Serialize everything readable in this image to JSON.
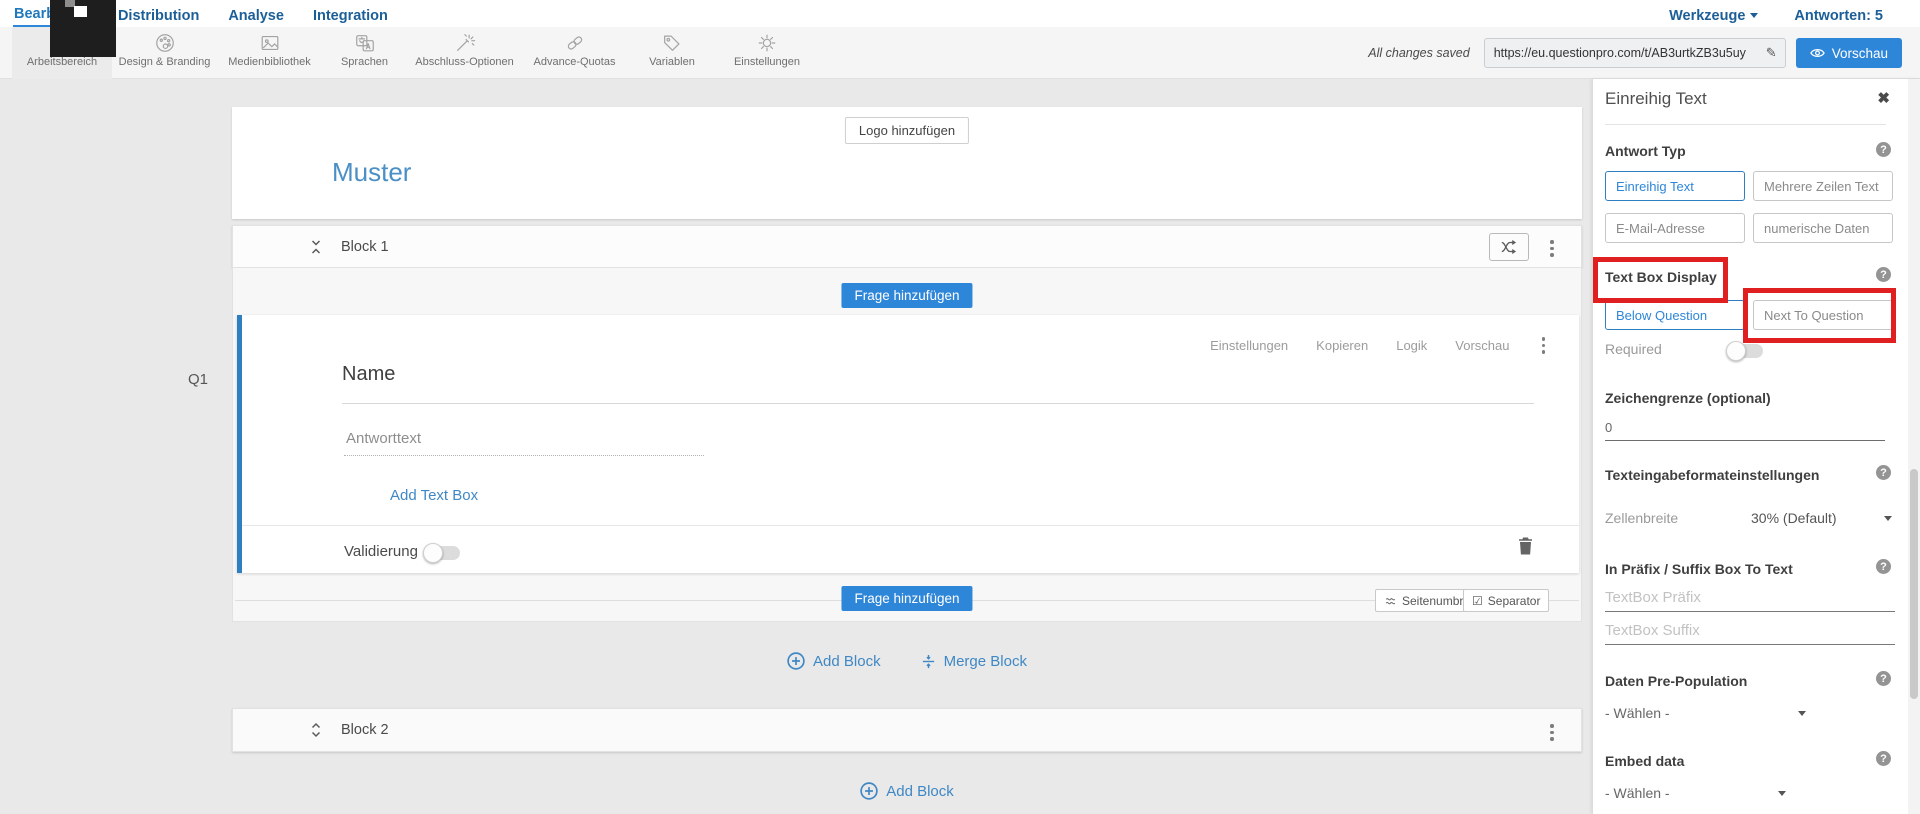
{
  "nav": {
    "tabs": [
      {
        "label": "Bearbeiten"
      },
      {
        "label": "Distribution"
      },
      {
        "label": "Analyse"
      },
      {
        "label": "Integration"
      }
    ],
    "tools_label": "Werkzeuge",
    "responses_label": "Antworten: 5"
  },
  "toolbar": {
    "items": [
      {
        "label": "Arbeitsbereich"
      },
      {
        "label": "Design & Branding"
      },
      {
        "label": "Medienbibliothek"
      },
      {
        "label": "Sprachen"
      },
      {
        "label": "Abschluss-Optionen"
      },
      {
        "label": "Advance-Quotas"
      },
      {
        "label": "Variablen"
      },
      {
        "label": "Einstellungen"
      }
    ],
    "save_status": "All changes saved",
    "url": "https://eu.questionpro.com/t/AB3urtkZB3u5uy",
    "preview_label": "Vorschau"
  },
  "canvas": {
    "logo_button": "Logo hinzufügen",
    "survey_title": "Muster",
    "question_number": "Q1",
    "block1_title": "Block 1",
    "block2_title": "Block 2",
    "add_question_label": "Frage hinzufügen",
    "question": {
      "actions": [
        {
          "label": "Einstellungen"
        },
        {
          "label": "Kopieren"
        },
        {
          "label": "Logik"
        },
        {
          "label": "Vorschau"
        }
      ],
      "name_label": "Name",
      "answer_placeholder": "Antworttext",
      "add_text_box_label": "Add Text Box",
      "validation_label": "Validierung"
    },
    "page_break_label": "Seitenumbruch",
    "separator_label": "Separator",
    "separator_checkbox_icon": "☑",
    "add_block_label": "Add Block",
    "merge_block_label": "Merge Block",
    "add_block_bottom_label": "Add Block"
  },
  "sidebar": {
    "title": "Einreihig Text",
    "close_icon": "✖",
    "help_icon": "?",
    "answer_type": {
      "label": "Antwort Typ",
      "options": [
        {
          "label": "Einreihig Text"
        },
        {
          "label": "Mehrere Zeilen Text"
        },
        {
          "label": "E-Mail-Adresse"
        },
        {
          "label": "numerische Daten"
        }
      ]
    },
    "text_box_display": {
      "label": "Text Box Display",
      "options": [
        {
          "label": "Below Question"
        },
        {
          "label": "Next To Question"
        }
      ]
    },
    "required_label": "Required",
    "char_limit": {
      "label": "Zeichengrenze (optional)",
      "value": "0"
    },
    "text_format": {
      "label": "Texteingabeformateinstellungen",
      "cell_width_label": "Zellenbreite",
      "cell_width_value": "30% (Default)"
    },
    "prefix_suffix": {
      "label": "In Präfix / Suffix Box To Text",
      "prefix_placeholder": "TextBox Präfix",
      "suffix_placeholder": "TextBox Suffix"
    },
    "data_prepopulation": {
      "label": "Daten Pre-Population",
      "value": "- Wählen -"
    },
    "embed_data": {
      "label": "Embed data",
      "value": "- Wählen -"
    }
  },
  "misc": {
    "pencil_icon": "✎"
  },
  "colors": {
    "accent_blue": "#2e86d8",
    "link_blue": "#3f88c5",
    "selected_blue": "#2d7fc1",
    "annotation_red": "#e02020",
    "nav_blue": "#1c5f98"
  }
}
